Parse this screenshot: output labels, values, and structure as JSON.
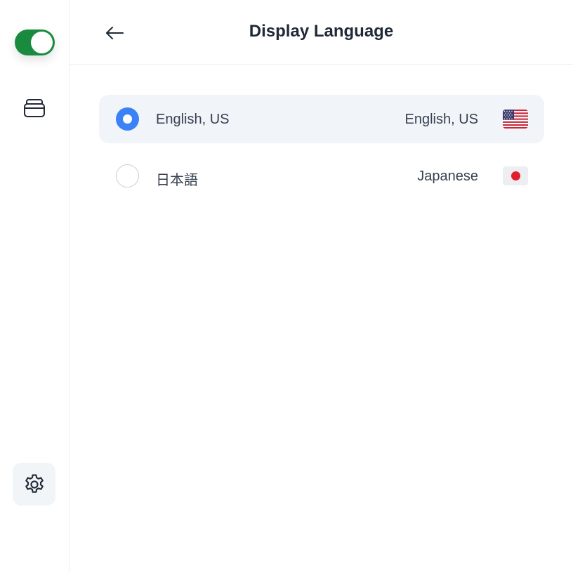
{
  "header": {
    "title": "Display Language",
    "back_icon": "arrow-left-icon"
  },
  "sidebar": {
    "toggle": {
      "state": "on",
      "color": "#1a8a3f"
    },
    "stack_icon": "stack-icon",
    "settings_icon": "gear-icon"
  },
  "languages": [
    {
      "native": "English, US",
      "english": "English, US",
      "flag": "us-flag-icon",
      "selected": true
    },
    {
      "native": "日本語",
      "english": "Japanese",
      "flag": "jp-flag-icon",
      "selected": false
    }
  ],
  "colors": {
    "accent": "#3b82f6",
    "selected_row": "#f1f4f8",
    "toggle_on": "#1a8a3f"
  }
}
